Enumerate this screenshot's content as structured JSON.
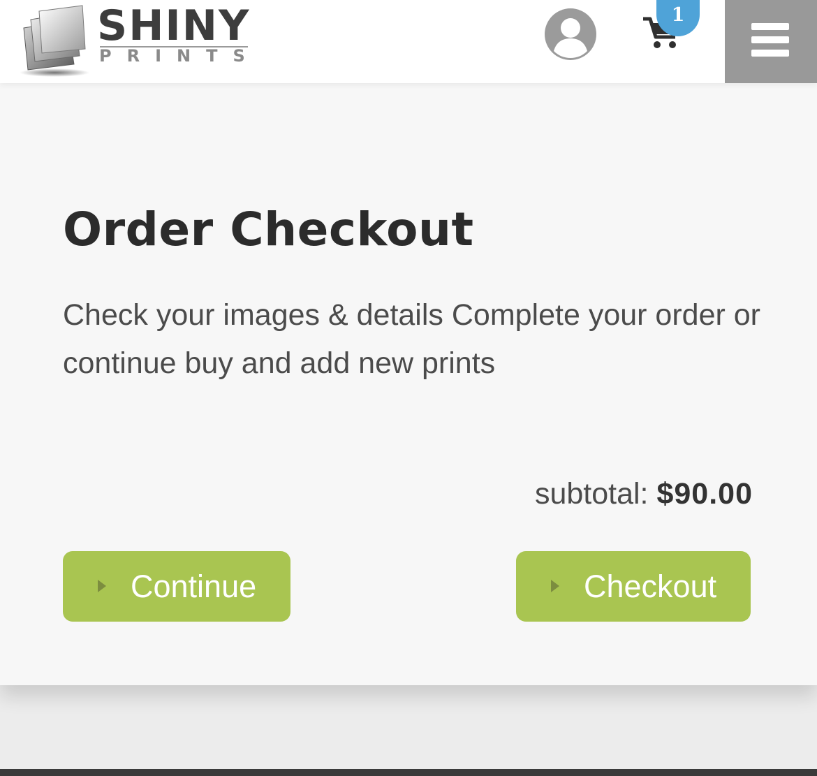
{
  "brand": {
    "name": "SHINY",
    "tagline": "PRINTS"
  },
  "header": {
    "cart_count": "1",
    "icons": {
      "account": "user-circle-icon",
      "cart": "shopping-cart-icon",
      "menu": "hamburger-menu-icon"
    }
  },
  "checkout": {
    "title": "Order Checkout",
    "description": "Check your images & details Complete your order or continue buy and add new prints",
    "subtotal_label": "subtotal:",
    "subtotal_value": "$90.00",
    "continue_label": "Continue",
    "checkout_label": "Checkout"
  },
  "colors": {
    "accent_green": "#a9c551",
    "badge_blue": "#4fa3d8",
    "menu_gray": "#999999",
    "text_dark": "#2b2b2b"
  }
}
